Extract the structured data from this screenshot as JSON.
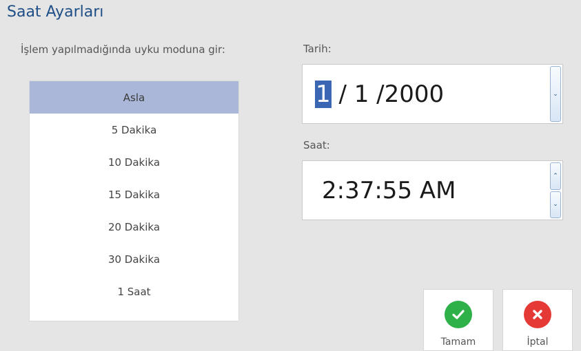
{
  "window": {
    "title": "Saat Ayarları"
  },
  "sleep": {
    "label": "İşlem yapılmadığında uyku moduna gir:",
    "options": [
      "Asla",
      "5 Dakika",
      "10 Dakika",
      "15 Dakika",
      "20 Dakika",
      "30 Dakika",
      "1 Saat"
    ],
    "selected": "Asla"
  },
  "date": {
    "label": "Tarih:",
    "selected_part": "1",
    "rest": " / 1 /2000"
  },
  "time": {
    "label": "Saat:",
    "value": "2:37:55 AM"
  },
  "actions": {
    "ok_label": "Tamam",
    "cancel_label": "İptal"
  },
  "colors": {
    "title": "#1f4f87",
    "selected_row": "#aab7d9",
    "ok_icon": "#2fb14a",
    "cancel_icon": "#e53935"
  },
  "icons": {
    "ok": "check-circle-icon",
    "cancel": "x-circle-icon",
    "spin_up": "chevron-up-icon",
    "spin_down": "chevron-down-icon"
  }
}
